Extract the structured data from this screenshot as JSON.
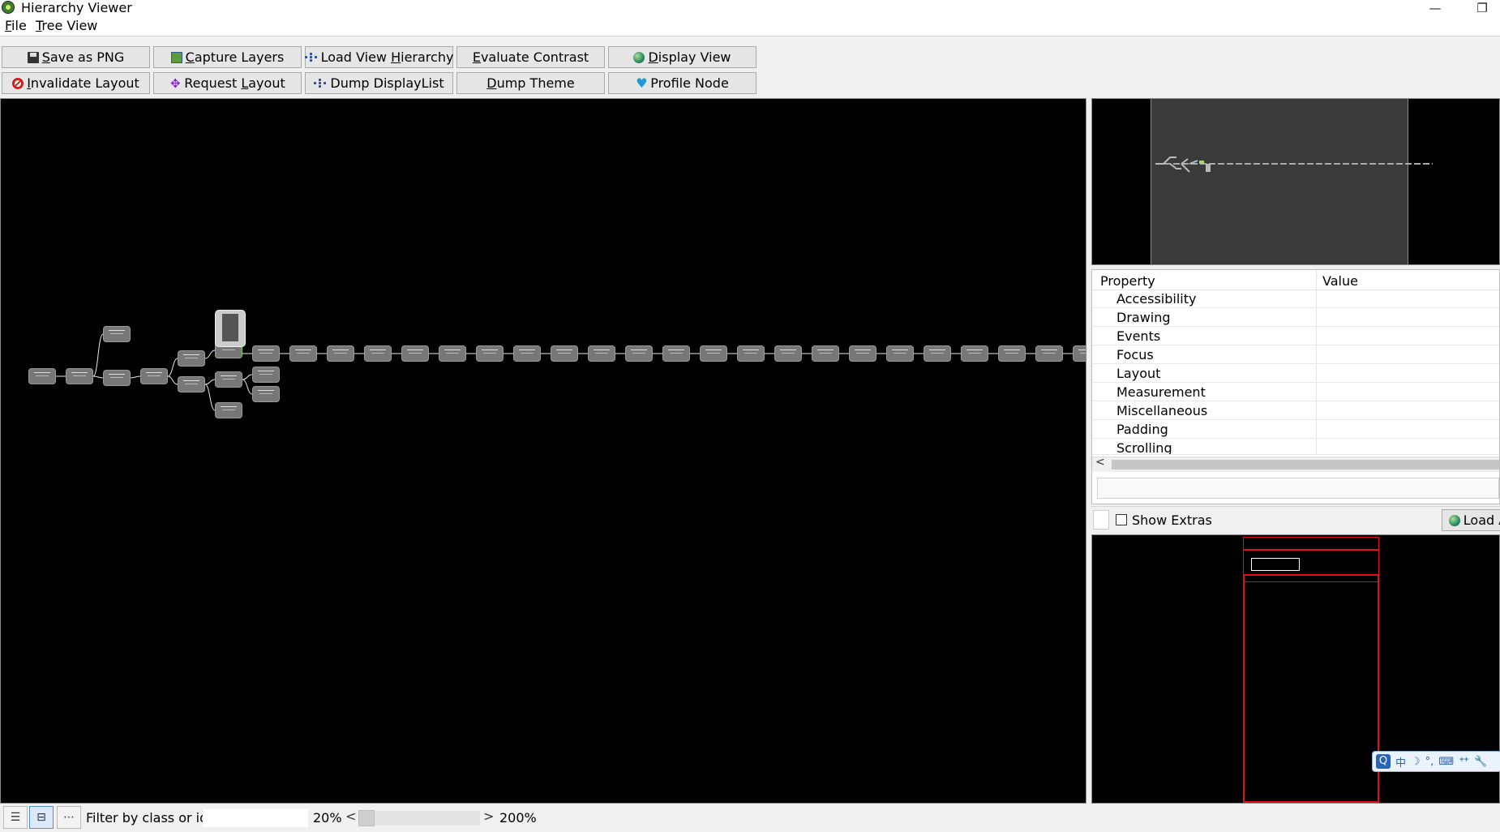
{
  "window": {
    "title": "Hierarchy Viewer",
    "minimize_glyph": "—",
    "restore_glyph": "❐"
  },
  "menu": [
    {
      "mnemonic": "F",
      "rest": "ile"
    },
    {
      "mnemonic": "T",
      "rest": "ree View"
    }
  ],
  "toolbar": {
    "row1": [
      {
        "icon": "floppy-disk-icon",
        "pre": "",
        "mnemonic": "S",
        "post": "ave as PNG"
      },
      {
        "icon": "layers-icon",
        "pre": "",
        "mnemonic": "C",
        "post": "apture Layers"
      },
      {
        "icon": "tree-hierarchy-icon",
        "pre": "Load View ",
        "mnemonic": "H",
        "post": "ierarchy"
      },
      {
        "icon": "",
        "pre": "",
        "mnemonic": "E",
        "post": "valuate Contrast"
      },
      {
        "icon": "globe-icon",
        "pre": "",
        "mnemonic": "D",
        "post": "isplay View"
      }
    ],
    "row2": [
      {
        "icon": "stop-sign-icon",
        "pre": "",
        "mnemonic": "I",
        "post": "nvalidate Layout"
      },
      {
        "icon": "move-arrows-icon",
        "pre": "Request ",
        "mnemonic": "L",
        "post": "ayout"
      },
      {
        "icon": "tree-hierarchy-icon",
        "pre": "Dump DisplayList",
        "mnemonic": "",
        "post": ""
      },
      {
        "icon": "",
        "pre": "",
        "mnemonic": "D",
        "post": "ump Theme"
      },
      {
        "icon": "heart-icon",
        "pre": "Profile Node",
        "mnemonic": "",
        "post": ""
      }
    ]
  },
  "properties": {
    "header_property": "Property",
    "header_value": "Value",
    "rows": [
      "Accessibility",
      "Drawing",
      "Events",
      "Focus",
      "Layout",
      "Measurement",
      "Miscellaneous",
      "Padding",
      "Scrolling"
    ]
  },
  "extras": {
    "show_extras_label": "Show Extras",
    "show_extras_checked": false,
    "load_button_label": "Load A"
  },
  "ime_toolbar": {
    "items": [
      "中",
      "☽",
      "°,",
      "⌨",
      "⺿",
      "🔧"
    ]
  },
  "statusbar": {
    "filter_label": "Filter by class or id:",
    "filter_value": "",
    "zoom_min": "20%",
    "zoom_max": "200%",
    "zoom_left_glyph": "<",
    "zoom_right_glyph": ">"
  },
  "colors": {
    "canvas_bg": "#000000",
    "node_fill": "#777777",
    "selection_red": "#e01010",
    "selected_node_accent": "#7ed04a"
  }
}
